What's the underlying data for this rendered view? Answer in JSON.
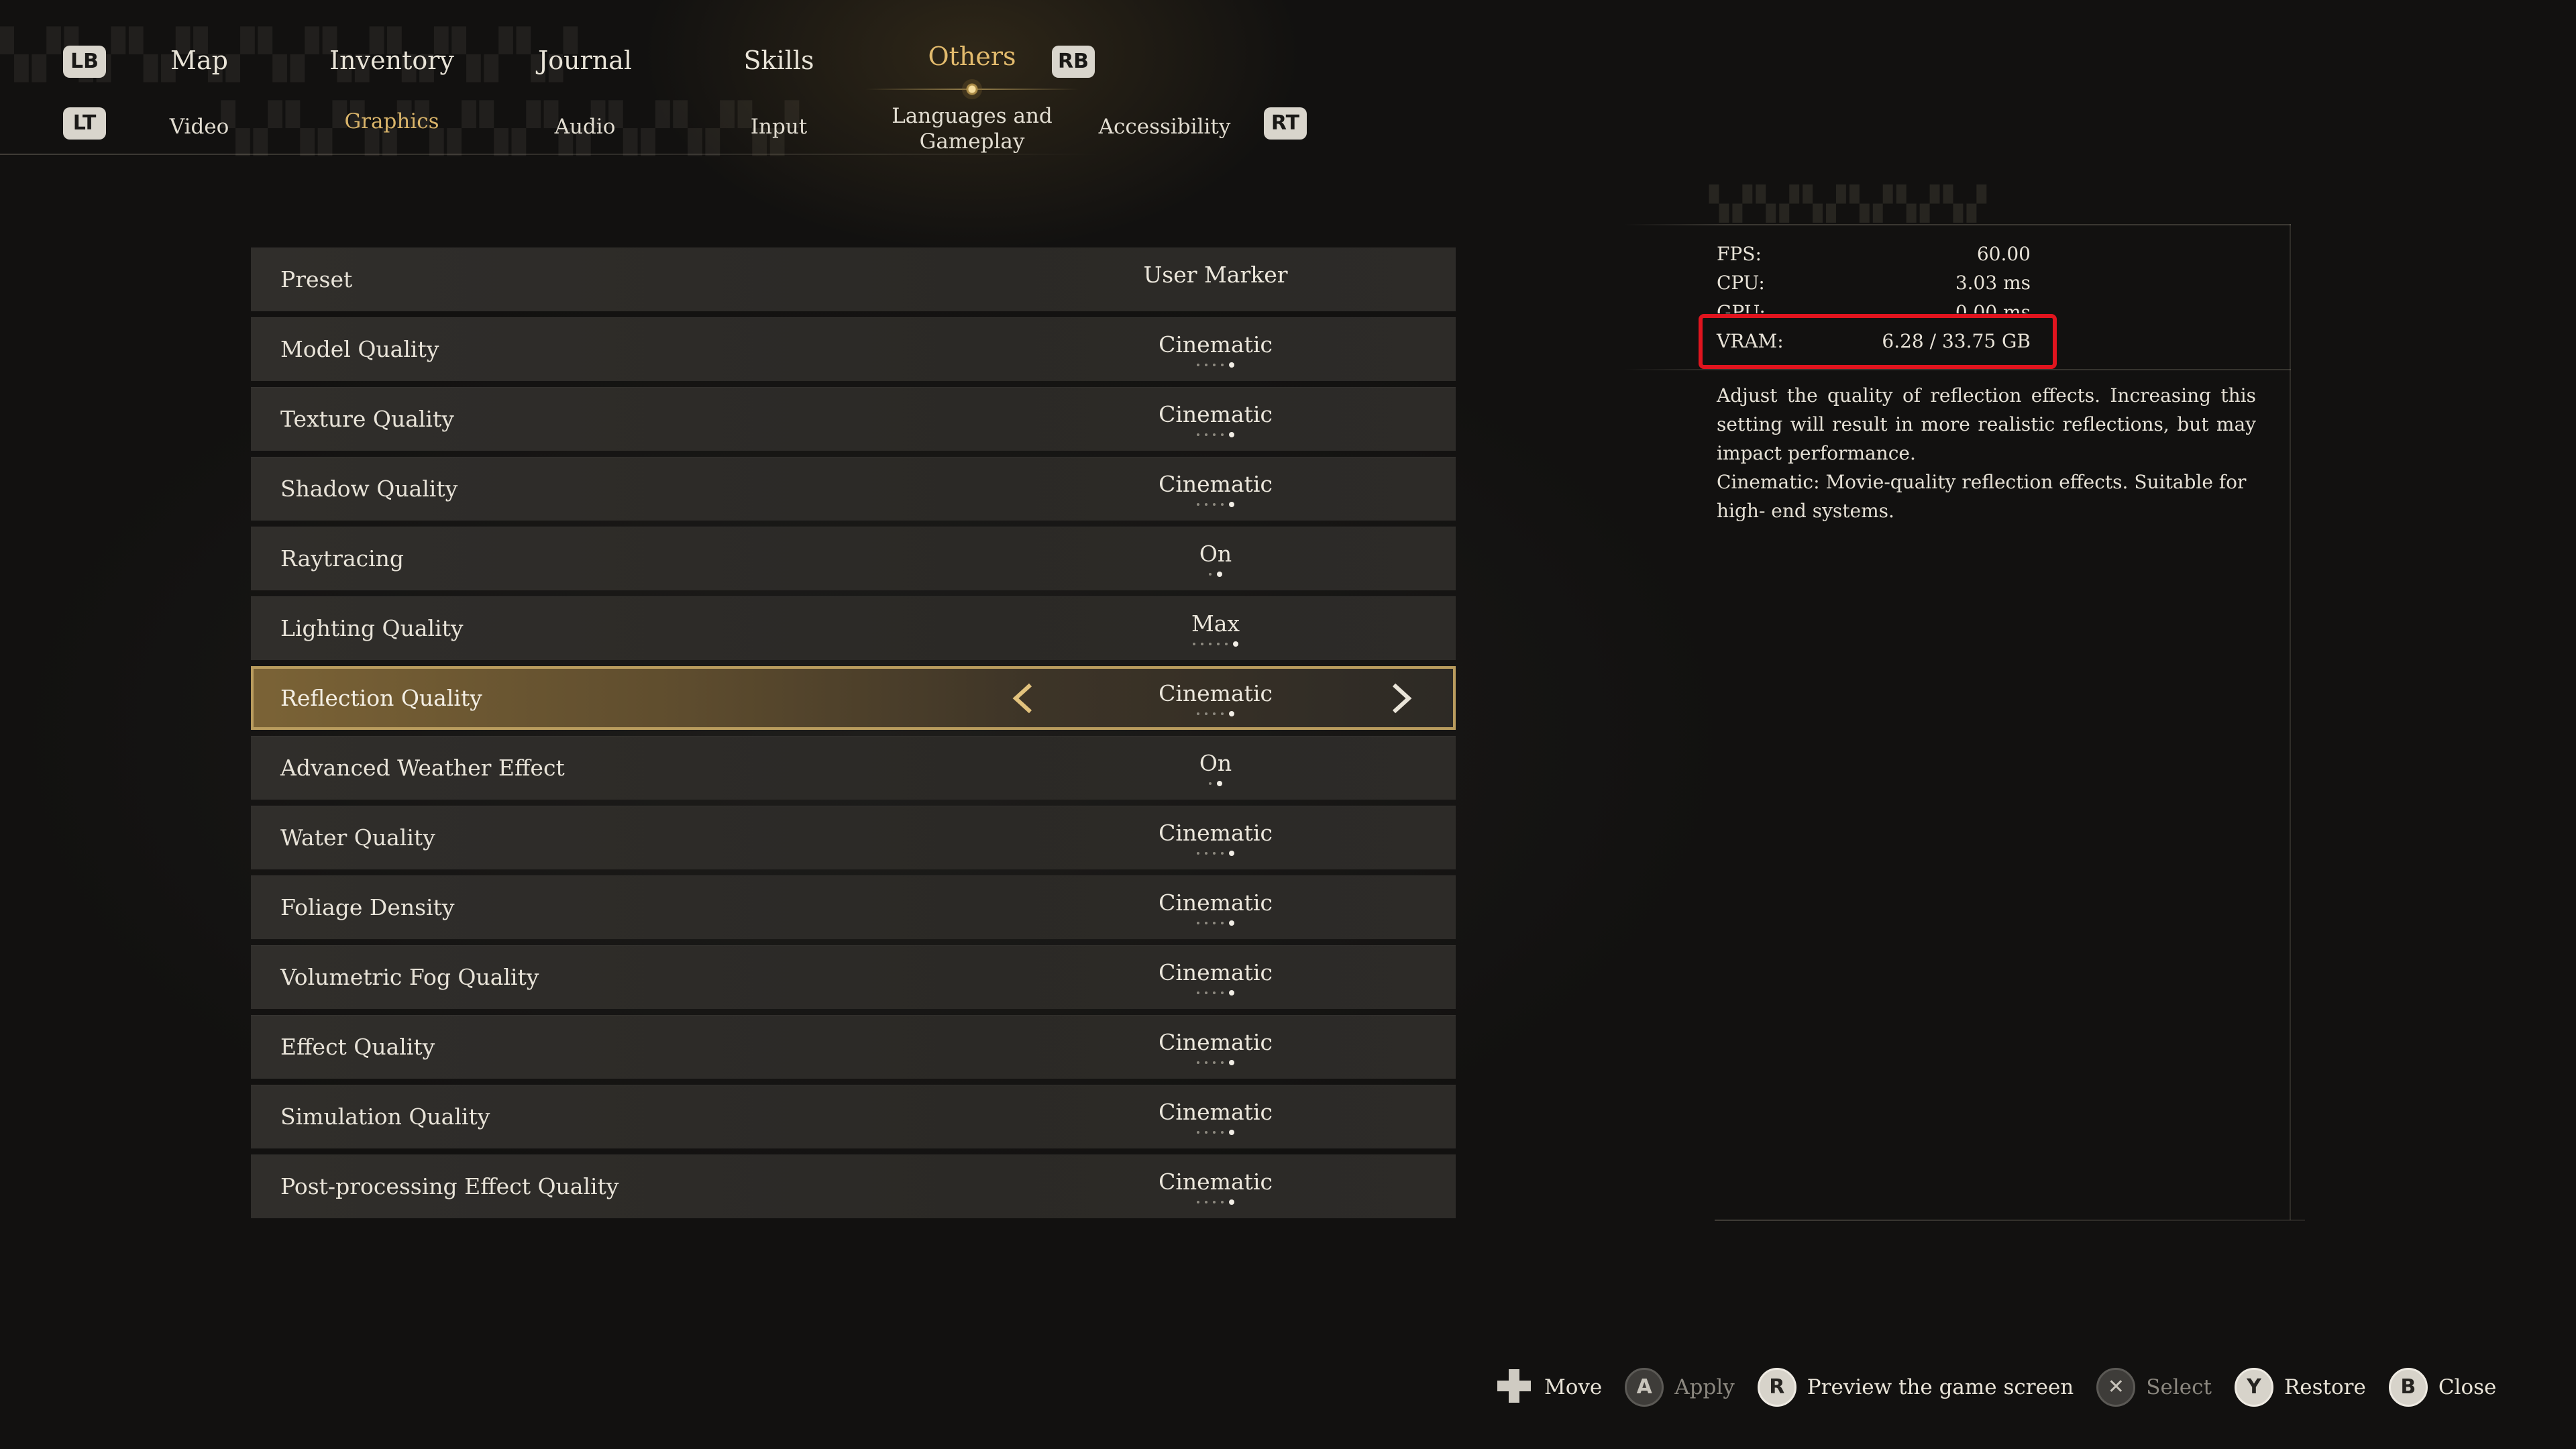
{
  "nav": {
    "left_bumper": "LB",
    "right_bumper": "RB",
    "left_trigger": "LT",
    "right_trigger": "RT",
    "tabs": [
      {
        "label": "Map"
      },
      {
        "label": "Inventory"
      },
      {
        "label": "Journal"
      },
      {
        "label": "Skills"
      },
      {
        "label": "Others",
        "active": true
      }
    ],
    "subtabs": [
      {
        "label": "Video"
      },
      {
        "label": "Graphics",
        "active": true
      },
      {
        "label": "Audio"
      },
      {
        "label": "Input"
      },
      {
        "label": "Languages and Gameplay"
      },
      {
        "label": "Accessibility"
      }
    ]
  },
  "settings": [
    {
      "label": "Preset",
      "value": "User Marker"
    },
    {
      "label": "Model Quality",
      "value": "Cinematic",
      "level": 5,
      "levels": 5
    },
    {
      "label": "Texture Quality",
      "value": "Cinematic",
      "level": 5,
      "levels": 5
    },
    {
      "label": "Shadow Quality",
      "value": "Cinematic",
      "level": 5,
      "levels": 5
    },
    {
      "label": "Raytracing",
      "value": "On",
      "level": 2,
      "levels": 2
    },
    {
      "label": "Lighting Quality",
      "value": "Max",
      "level": 6,
      "levels": 6
    },
    {
      "label": "Reflection Quality",
      "value": "Cinematic",
      "level": 5,
      "levels": 5,
      "selected": true
    },
    {
      "label": "Advanced Weather Effect",
      "value": "On",
      "level": 2,
      "levels": 2
    },
    {
      "label": "Water Quality",
      "value": "Cinematic",
      "level": 5,
      "levels": 5
    },
    {
      "label": "Foliage Density",
      "value": "Cinematic",
      "level": 5,
      "levels": 5
    },
    {
      "label": "Volumetric Fog Quality",
      "value": "Cinematic",
      "level": 5,
      "levels": 5
    },
    {
      "label": "Effect Quality",
      "value": "Cinematic",
      "level": 5,
      "levels": 5
    },
    {
      "label": "Simulation Quality",
      "value": "Cinematic",
      "level": 5,
      "levels": 5
    },
    {
      "label": "Post-processing Effect Quality",
      "value": "Cinematic",
      "level": 5,
      "levels": 5
    }
  ],
  "stats": {
    "fps_label": "FPS:",
    "fps_value": "60.00",
    "cpu_label": "CPU:",
    "cpu_value": "3.03 ms",
    "gpu_label": "GPU:",
    "gpu_value": "0.00 ms",
    "vram_label": "VRAM:",
    "vram_value": "6.28 / 33.75 GB"
  },
  "description": {
    "line1": "Adjust the quality of reflection effects. Increasing this setting will result in more realistic reflections, but may impact performance.",
    "line2": "Cinematic: Movie-quality reflection effects. Suitable for high- end systems."
  },
  "hints": [
    {
      "icon": "dpad-icon",
      "glyph": "",
      "label": "Move",
      "dim": false
    },
    {
      "icon": "a-button-icon",
      "glyph": "A",
      "label": "Apply",
      "dim": true
    },
    {
      "icon": "r-stick-icon",
      "glyph": "R",
      "label": "Preview the game screen",
      "dim": false
    },
    {
      "icon": "x-button-icon",
      "glyph": "✕",
      "label": "Select",
      "dim": true
    },
    {
      "icon": "y-button-icon",
      "glyph": "Y",
      "label": "Restore",
      "dim": false
    },
    {
      "icon": "b-button-icon",
      "glyph": "B",
      "label": "Close",
      "dim": false
    }
  ],
  "colors": {
    "accent": "#d9b46a",
    "selected_border": "#b99c5e",
    "highlight_box": "#e0141e"
  }
}
